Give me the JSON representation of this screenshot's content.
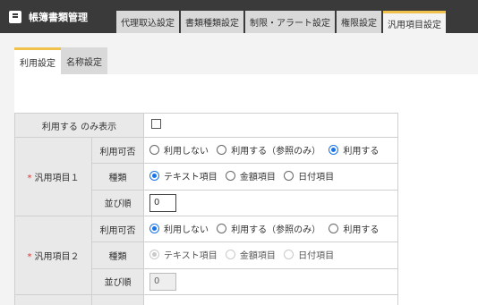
{
  "app": {
    "title": "帳簿書類管理",
    "icon": "book-icon"
  },
  "tabs": [
    {
      "label": "代理取込設定",
      "active": false
    },
    {
      "label": "書類種類設定",
      "active": false
    },
    {
      "label": "制限・アラート設定",
      "active": false
    },
    {
      "label": "権限設定",
      "active": false
    },
    {
      "label": "汎用項目設定",
      "active": true
    }
  ],
  "subtabs": [
    {
      "label": "利用設定",
      "active": true
    },
    {
      "label": "名称設定",
      "active": false
    }
  ],
  "form": {
    "show_only_label": "利用する のみ表示",
    "sub_labels": {
      "usage": "利用可否",
      "type": "種類",
      "order": "並び順"
    },
    "usage_options": [
      "利用しない",
      "利用する（参照のみ）",
      "利用する"
    ],
    "type_options": [
      "テキスト項目",
      "金額項目",
      "日付項目"
    ],
    "items": [
      {
        "label": "汎用項目１",
        "usage_selected": 2,
        "type_selected": 0,
        "order": "0",
        "disabled": false
      },
      {
        "label": "汎用項目２",
        "usage_selected": 0,
        "type_selected": 0,
        "order": "0",
        "disabled": true
      }
    ]
  },
  "colors": {
    "accent": "#f0c14b",
    "radio": "#1a73e8",
    "header": "#3a3a3a"
  }
}
